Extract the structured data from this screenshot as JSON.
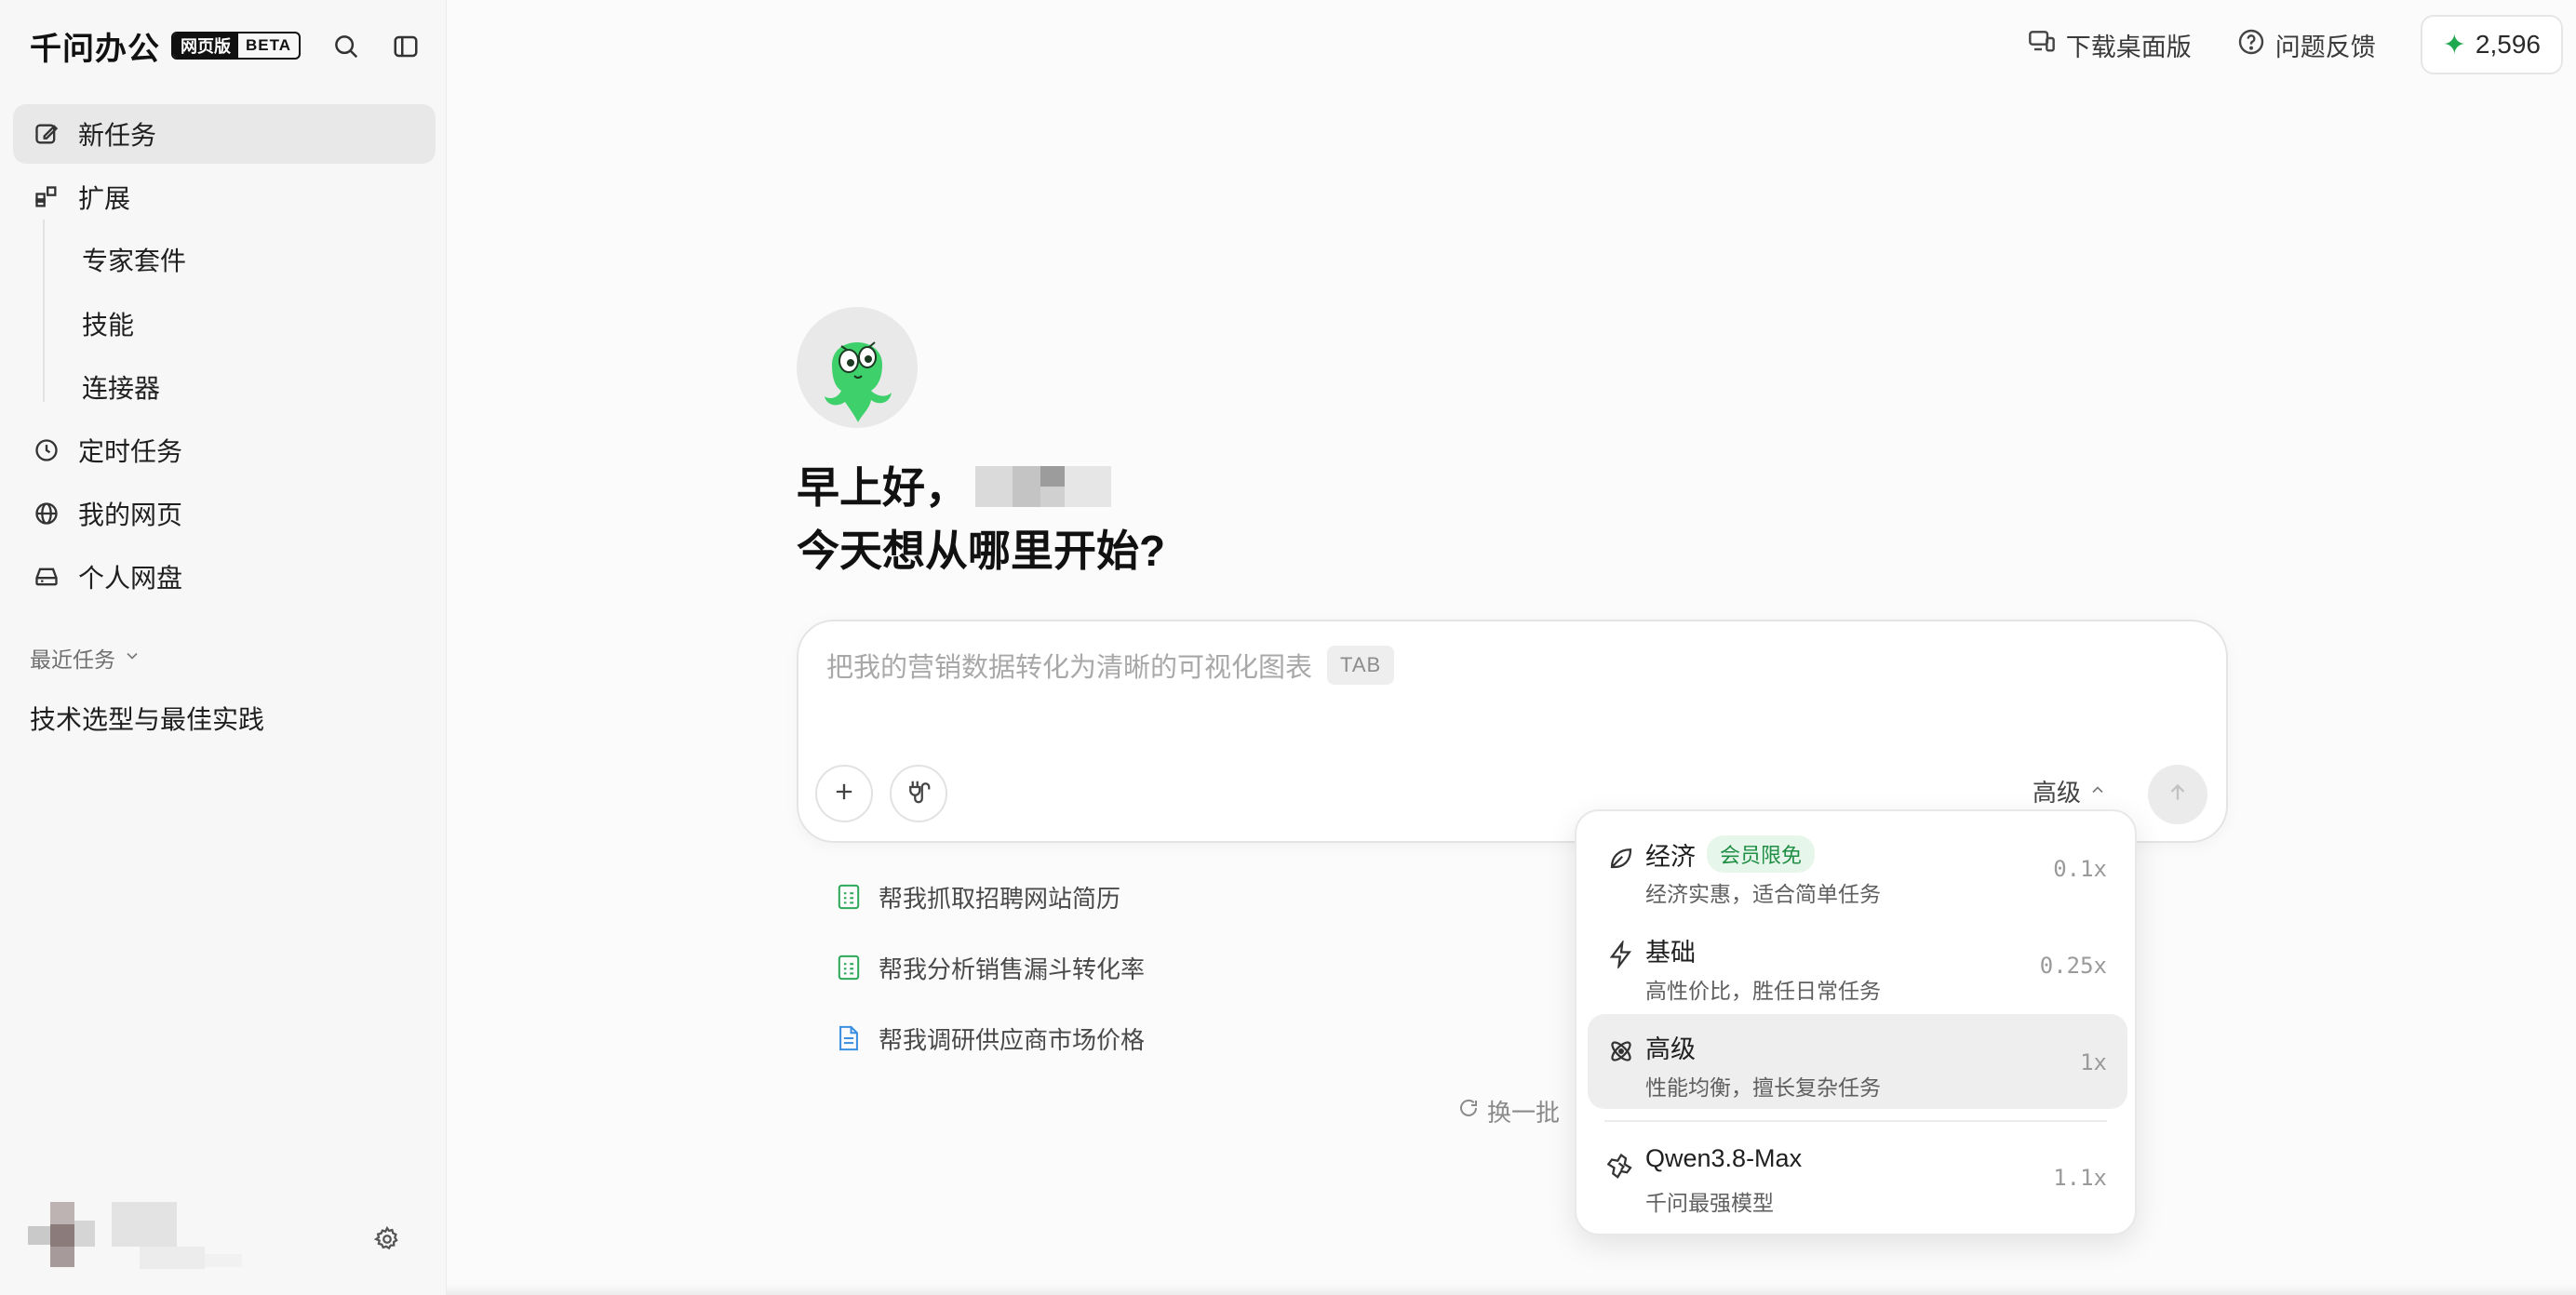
{
  "brand": {
    "name": "千问办公",
    "badge_main": "网页版",
    "badge_beta": "BETA"
  },
  "sidebar": {
    "nav": [
      {
        "label": "新任务",
        "icon": "edit-icon"
      },
      {
        "label": "扩展",
        "icon": "extensions-icon"
      }
    ],
    "sub_items": [
      {
        "label": "专家套件"
      },
      {
        "label": "技能"
      },
      {
        "label": "连接器"
      }
    ],
    "nav2": [
      {
        "label": "定时任务",
        "icon": "clock-icon"
      },
      {
        "label": "我的网页",
        "icon": "globe-icon"
      },
      {
        "label": "个人网盘",
        "icon": "drive-icon"
      }
    ],
    "recent_label": "最近任务",
    "recent_items": [
      "技术选型与最佳实践"
    ]
  },
  "topbar": {
    "download_label": "下载桌面版",
    "feedback_label": "问题反馈",
    "credits": "2,596"
  },
  "greeting": {
    "line1": "早上好，",
    "line2": "今天想从哪里开始?"
  },
  "composer": {
    "placeholder": "把我的营销数据转化为清晰的可视化图表",
    "tab_hint": "TAB",
    "model_label": "高级"
  },
  "suggestions": [
    {
      "label": "帮我抓取招聘网站简历",
      "icon": "spreadsheet-icon"
    },
    {
      "label": "帮我分析销售漏斗转化率",
      "icon": "spreadsheet-icon"
    },
    {
      "label": "帮我调研供应商市场价格",
      "icon": "document-icon"
    }
  ],
  "refresh_label": "换一批",
  "model_menu": {
    "options": [
      {
        "title": "经济",
        "tag": "会员限免",
        "desc": "经济实惠，适合简单任务",
        "mult": "0.1x",
        "icon": "leaf-icon"
      },
      {
        "title": "基础",
        "desc": "高性价比，胜任日常任务",
        "mult": "0.25x",
        "icon": "lightning-icon"
      },
      {
        "title": "高级",
        "desc": "性能均衡，擅长复杂任务",
        "mult": "1x",
        "icon": "atom-icon",
        "selected": true
      },
      {
        "title": "Qwen3.8-Max",
        "desc": "千问最强模型",
        "mult": "1.1x",
        "icon": "qwen-logo-icon"
      }
    ]
  },
  "colors": {
    "accent_green": "#1fa84f",
    "tag_bg": "#e6f6ea",
    "selected_bg": "#eeeeee"
  }
}
